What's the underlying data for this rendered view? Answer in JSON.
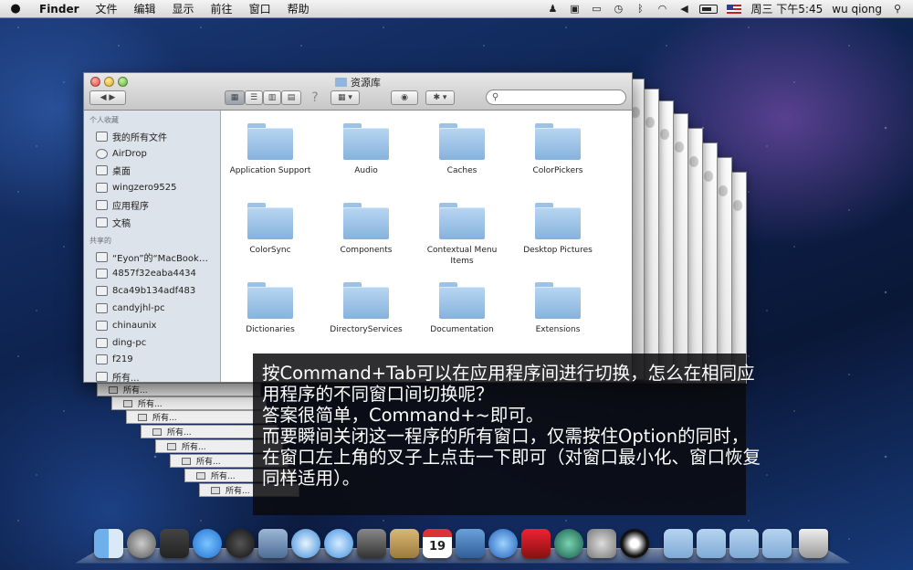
{
  "menubar": {
    "apple": "",
    "app": "Finder",
    "items": [
      "文件",
      "编辑",
      "显示",
      "前往",
      "窗口",
      "帮助"
    ],
    "clock": "周三 下午5:45",
    "user": "wu qiong"
  },
  "finder": {
    "title": "资源库",
    "search_placeholder": "",
    "sidebar": {
      "favorites_header": "个人收藏",
      "favorites": [
        "我的所有文件",
        "AirDrop",
        "桌面",
        "wingzero9525",
        "应用程序",
        "文稿"
      ],
      "shared_header": "共享的",
      "shared": [
        "“Eyon”的“MacBook…",
        "4857f32eaba4434",
        "8ca49b134adf483",
        "candyjhl-pc",
        "chinaunix",
        "ding-pc",
        "f219",
        "所有..."
      ]
    },
    "folders": [
      {
        "label": "Application Support"
      },
      {
        "label": "Audio"
      },
      {
        "label": "Caches"
      },
      {
        "label": "ColorPickers"
      },
      {
        "label": "ColorSync"
      },
      {
        "label": "Components"
      },
      {
        "label": "Contextual Menu Items"
      },
      {
        "label": "Desktop Pictures"
      },
      {
        "label": "Dictionaries"
      },
      {
        "label": "DirectoryServices"
      },
      {
        "label": "Documentation"
      },
      {
        "label": "Extensions"
      }
    ]
  },
  "stack_labels": [
    "所有...",
    "所有...",
    "所有...",
    "所有...",
    "所有...",
    "所有...",
    "所有...",
    "所有..."
  ],
  "caption": {
    "lines": [
      "按Command+Tab可以在应用程序间进行切换，怎么在相同应",
      "用程序的不同窗口间切换呢？",
      "答案很简单，Command+~即可。",
      "而要瞬间关闭这一程序的所有窗口，仅需按住Option的同时，",
      "在窗口左上角的叉子上点击一下即可（对窗口最小化、窗口恢复",
      "同样适用）。"
    ]
  },
  "calendar_day": "19",
  "dock_icons": [
    "finder-icon",
    "launchpad-icon",
    "mission-control-icon",
    "app-store-icon",
    "dashboard-icon",
    "preview-icon",
    "safari-icon",
    "messages-icon",
    "facetime-icon",
    "address-book-icon",
    "calendar-icon",
    "iphoto-icon",
    "itunes-icon",
    "photo-booth-icon",
    "time-machine-icon",
    "system-preferences-icon",
    "qq-icon",
    "applications-stack-icon",
    "documents-stack-icon",
    "downloads-stack-icon",
    "folder-stack-icon",
    "trash-icon"
  ],
  "colors": {
    "dock_shelf": "#c8d0dc",
    "folder": "#9cc2e6",
    "caption_bg": "#0a0a0e"
  }
}
